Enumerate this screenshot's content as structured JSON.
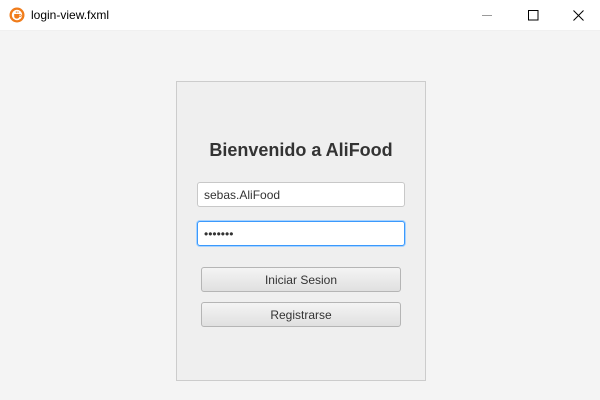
{
  "window": {
    "title": "login-view.fxml",
    "icon": "java-cup-icon",
    "controls": {
      "minimize_icon": "minimize-icon",
      "maximize_icon": "maximize-icon",
      "close_icon": "close-icon"
    }
  },
  "login": {
    "heading": "Bienvenido a AliFood",
    "username_value": "sebas.AliFood",
    "password_value": "sebasss",
    "login_button_label": "Iniciar Sesion",
    "register_button_label": "Registrarse"
  },
  "colors": {
    "background": "#f4f4f4",
    "panel": "#efefef",
    "focus_accent": "#3b99fc",
    "icon_accent": "#f07c1b"
  }
}
